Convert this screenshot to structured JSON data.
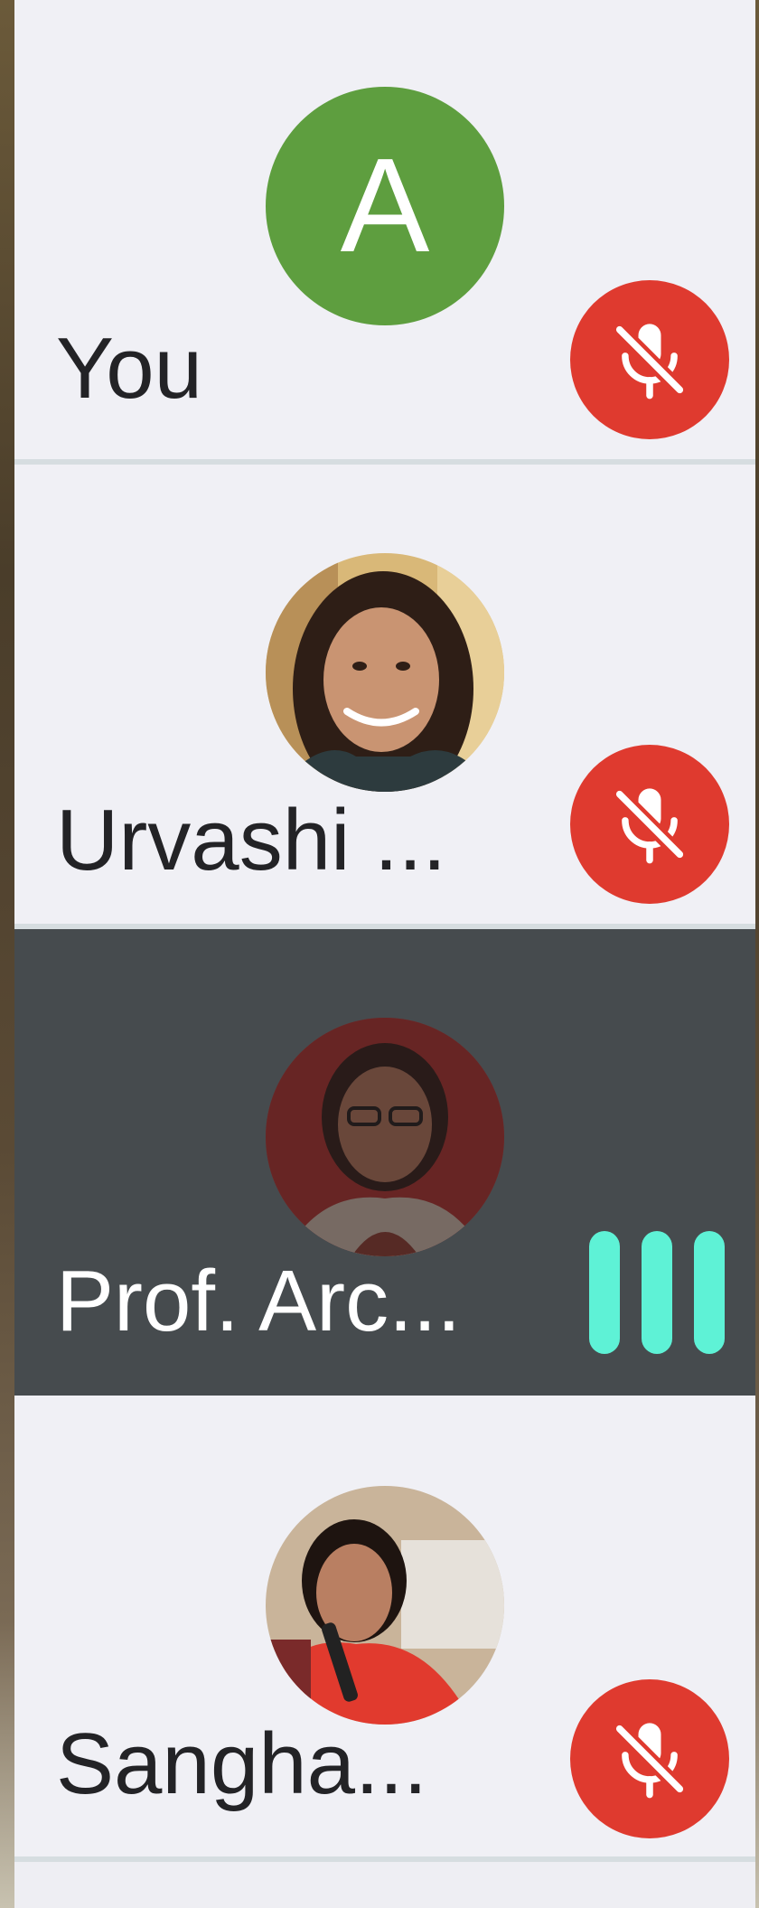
{
  "participants": [
    {
      "name": "You",
      "avatar_initial": "A",
      "avatar_color": "#5e9e3f",
      "status": "muted",
      "status_icon": "mic-off-icon"
    },
    {
      "name": "Urvashi ...",
      "avatar": "photo",
      "status": "muted",
      "status_icon": "mic-off-icon"
    },
    {
      "name": "Prof. Arc...",
      "avatar": "photo",
      "status": "speaking",
      "status_icon": "audio-level-icon",
      "highlighted": true
    },
    {
      "name": "Sangha...",
      "avatar": "photo",
      "status": "muted",
      "status_icon": "mic-off-icon"
    }
  ],
  "colors": {
    "muted_badge": "#df3a2f",
    "speaking_indicator": "#5ef2d6",
    "active_tile": "#464b4e",
    "tile": "#f0f0f5"
  }
}
